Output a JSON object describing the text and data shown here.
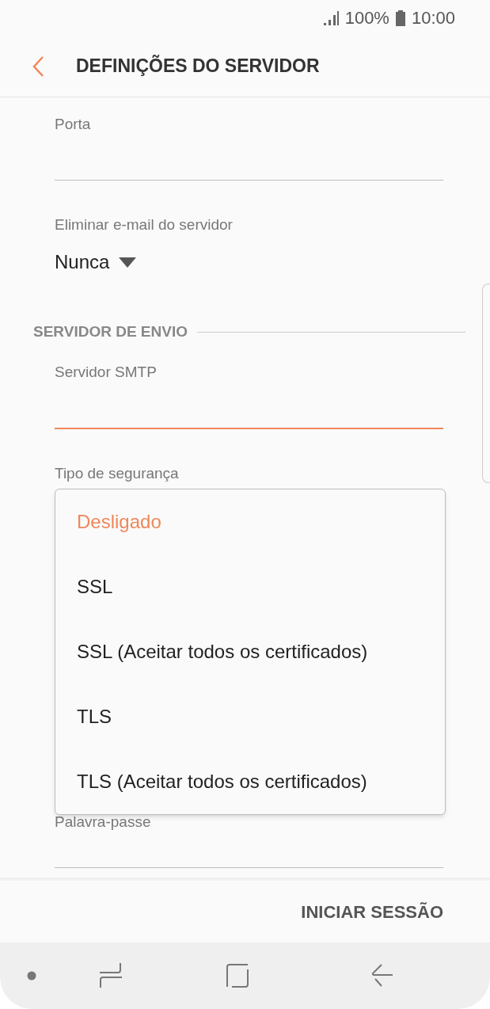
{
  "status_bar": {
    "battery": "100%",
    "time": "10:00"
  },
  "header": {
    "title": "DEFINIÇÕES DO SERVIDOR"
  },
  "fields": [
    {
      "kind": "text",
      "label": "Porta",
      "focused": false
    },
    {
      "kind": "select",
      "label": "Eliminar e-mail do servidor",
      "value": "Nunca"
    },
    {
      "kind": "section",
      "label": "SERVIDOR DE ENVIO"
    },
    {
      "kind": "text",
      "label": "Servidor SMTP",
      "focused": true
    },
    {
      "kind": "select",
      "label": "Tipo de segurança",
      "expanded": true,
      "options": [
        {
          "label": "Desligado",
          "selected": true
        },
        {
          "label": "SSL",
          "selected": false
        },
        {
          "label": "SSL (Aceitar todos os certificados)",
          "selected": false
        },
        {
          "label": "TLS",
          "selected": false
        },
        {
          "label": "TLS (Aceitar todos os certificados)",
          "selected": false
        }
      ]
    },
    {
      "kind": "text",
      "label": "Palavra-passe",
      "focused": false
    }
  ],
  "footer": {
    "button": "INICIAR SESSÃO"
  }
}
